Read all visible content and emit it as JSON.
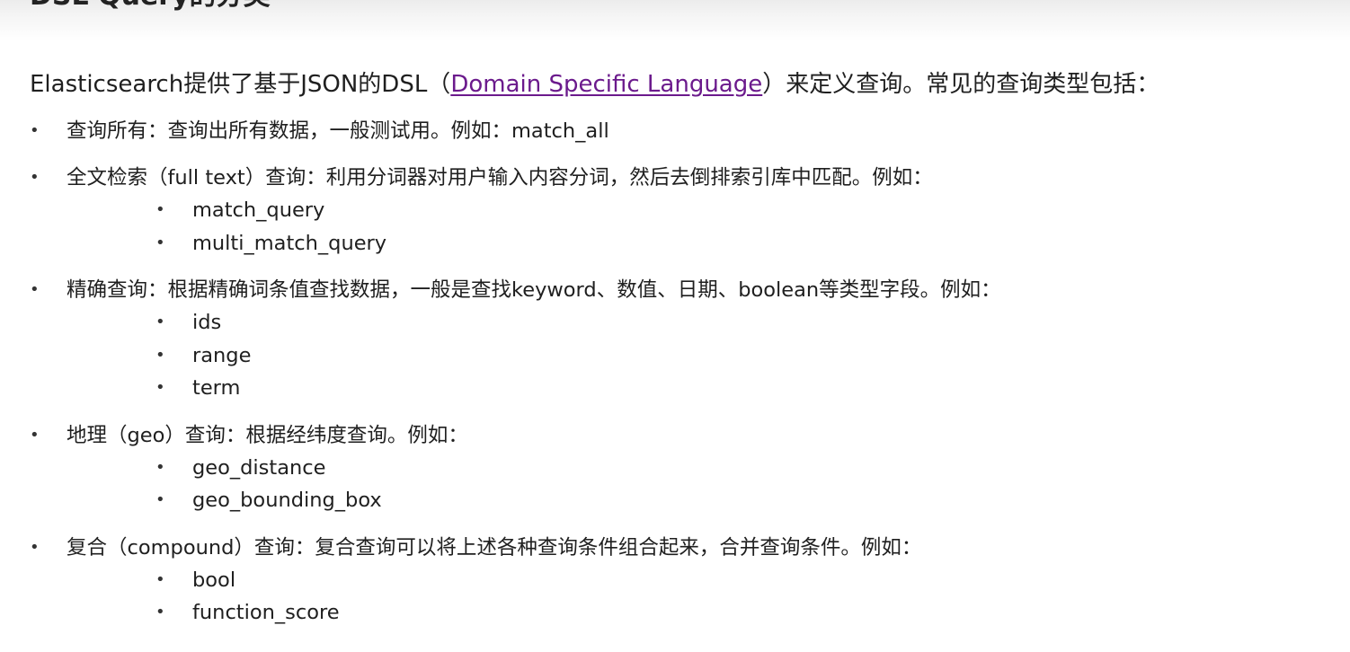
{
  "heading": "DSL Query的分类",
  "intro": {
    "before": "Elasticsearch提供了基于JSON的DSL（",
    "link": "Domain Specific  Language",
    "after": "）来定义查询。常见的查询类型包括："
  },
  "bullet_glyph": "•",
  "items": [
    {
      "text": "查询所有：查询出所有数据，一般测试用。例如：match_all",
      "subs": []
    },
    {
      "text": "全文检索（full text）查询：利用分词器对用户输入内容分词，然后去倒排索引库中匹配。例如：",
      "subs": [
        "match_query",
        "multi_match_query"
      ]
    },
    {
      "text": "精确查询：根据精确词条值查找数据，一般是查找keyword、数值、日期、boolean等类型字段。例如：",
      "subs": [
        "ids",
        "range",
        "term"
      ]
    },
    {
      "text": "地理（geo）查询：根据经纬度查询。例如：",
      "subs": [
        "geo_distance",
        "geo_bounding_box"
      ]
    },
    {
      "text": "复合（compound）查询：复合查询可以将上述各种查询条件组合起来，合并查询条件。例如：",
      "subs": [
        "bool",
        "function_score"
      ]
    }
  ],
  "colors": {
    "text": "#1f1f1f",
    "link": "#6b1a8c",
    "background": "#ffffff"
  }
}
